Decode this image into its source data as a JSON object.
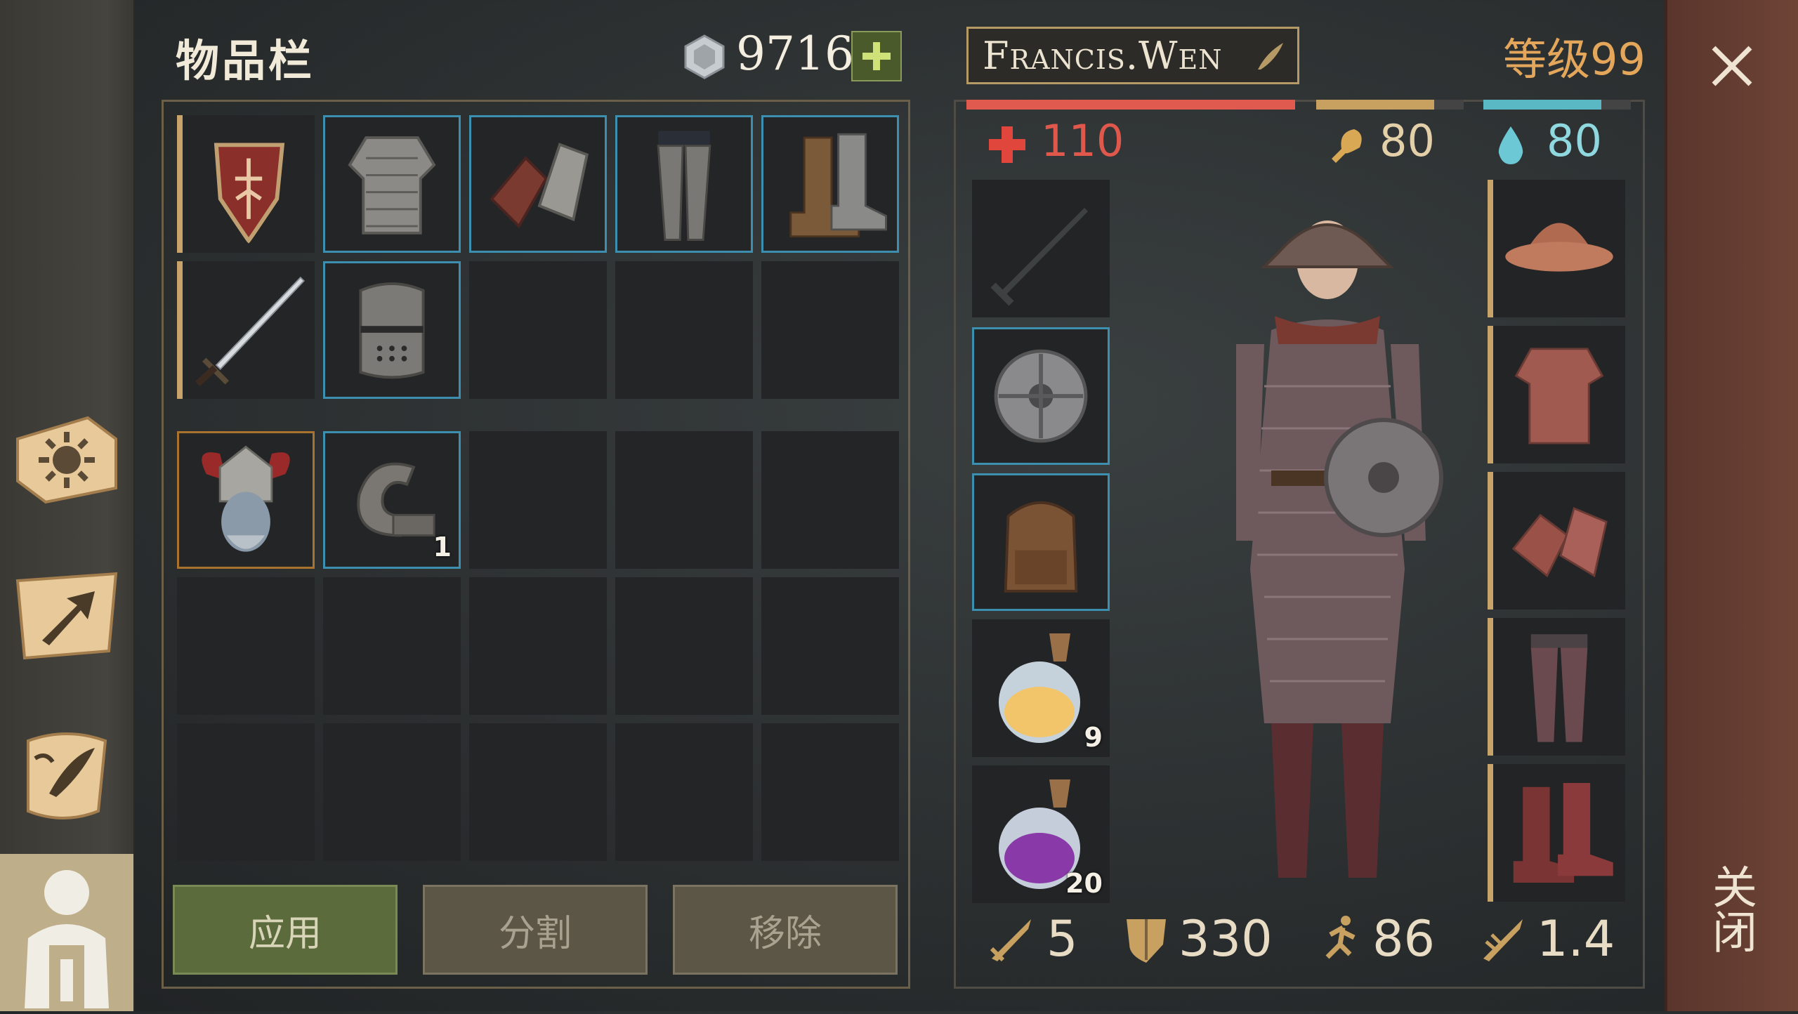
{
  "inventory": {
    "title": "物品栏",
    "silver": "9716",
    "items": [
      {
        "name": "shield",
        "count": ""
      },
      {
        "name": "scale-armor",
        "count": ""
      },
      {
        "name": "gauntlets",
        "count": ""
      },
      {
        "name": "leg-armor",
        "count": ""
      },
      {
        "name": "boots",
        "count": ""
      },
      {
        "name": "sword",
        "count": ""
      },
      {
        "name": "great-helm",
        "count": ""
      },
      {
        "name": "horned-head-trophy",
        "count": ""
      },
      {
        "name": "iron-ring",
        "count": "1"
      }
    ]
  },
  "actions": {
    "apply": "应用",
    "split": "分割",
    "remove": "移除"
  },
  "character": {
    "name": "Francis.Wen",
    "level": "等级99",
    "health": "110",
    "hunger": "80",
    "thirst": "80",
    "health_fraction": 1.0,
    "hunger_fraction": 0.8,
    "thirst_fraction": 0.8,
    "potion_yellow_count": "9",
    "potion_purple_count": "20"
  },
  "stats": {
    "attack": "5",
    "defense": "330",
    "speed": "86",
    "attack_speed": "1.4"
  },
  "close": {
    "label": "关闭"
  },
  "colors": {
    "health": "#e05a50",
    "hunger": "#c8a060",
    "thirst": "#5ab8c4",
    "rare_border": "#3d8fb0",
    "common_border": "#c9a46a"
  }
}
